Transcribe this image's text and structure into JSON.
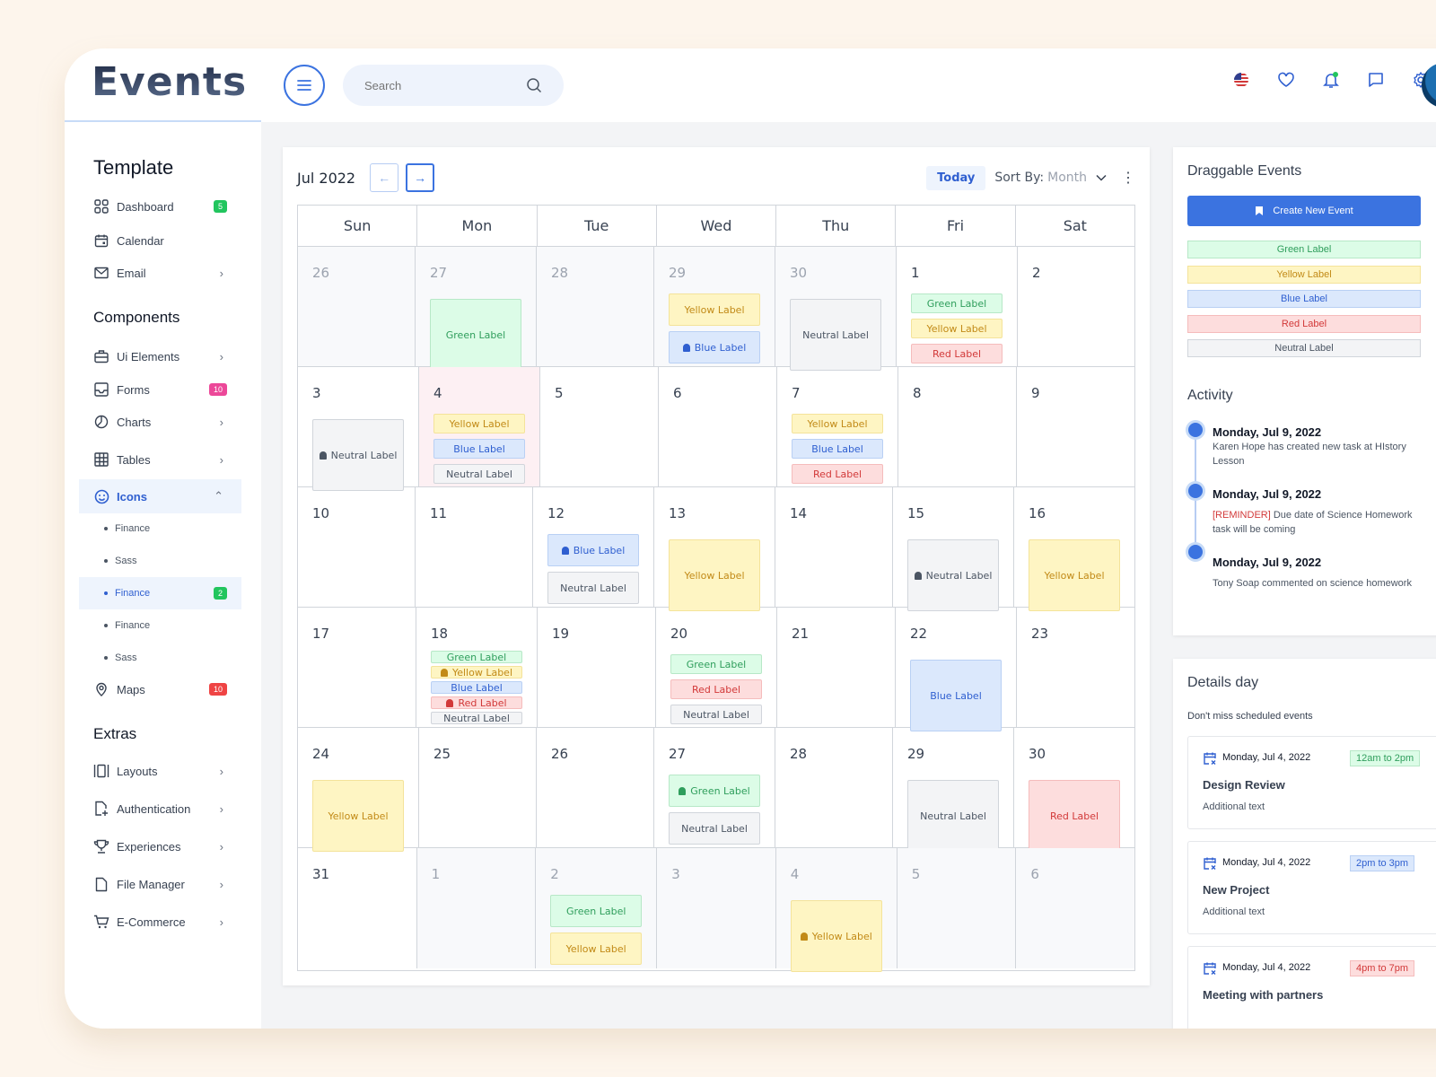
{
  "app": {
    "title": "Events"
  },
  "topbar": {
    "search_placeholder": "Search",
    "icons": [
      "us-flag-icon",
      "heart-icon",
      "bell-icon",
      "chat-icon",
      "gear-icon"
    ]
  },
  "sidebar": {
    "sections": {
      "template": "Template",
      "components": "Components",
      "extras": "Extras"
    },
    "template_items": [
      {
        "label": "Dashboard",
        "badge": "5",
        "badge_color": "#22c55e"
      },
      {
        "label": "Calendar"
      },
      {
        "label": "Email",
        "chevron": true
      }
    ],
    "component_items": [
      {
        "label": "Ui Elements",
        "chevron": true
      },
      {
        "label": "Forms",
        "badge": "10",
        "badge_color": "#ec4899"
      },
      {
        "label": "Charts",
        "chevron": true
      },
      {
        "label": "Tables",
        "chevron": true
      },
      {
        "label": "Icons",
        "expanded": true,
        "active": true
      }
    ],
    "icons_subitems": [
      {
        "label": "Finance"
      },
      {
        "label": "Sass"
      },
      {
        "label": "Finance",
        "active": true,
        "badge": "2",
        "badge_color": "#22c55e"
      },
      {
        "label": "Finance"
      },
      {
        "label": "Sass"
      }
    ],
    "maps": {
      "label": "Maps",
      "badge": "10",
      "badge_color": "#ef4444"
    },
    "extra_items": [
      {
        "label": "Layouts"
      },
      {
        "label": "Authentication"
      },
      {
        "label": "Experiences"
      },
      {
        "label": "File Manager"
      },
      {
        "label": "E-Commerce"
      }
    ]
  },
  "calendar": {
    "month_label": "Jul 2022",
    "today_label": "Today",
    "sort_label": "Sort By:",
    "sort_value": "Month",
    "weekdays": [
      "Sun",
      "Mon",
      "Tue",
      "Wed",
      "Thu",
      "Fri",
      "Sat"
    ],
    "weeks": [
      [
        {
          "d": "26",
          "muted": true,
          "events": []
        },
        {
          "d": "27",
          "muted": true,
          "layout": "tall",
          "events": [
            {
              "c": "green",
              "t": "Green Label"
            }
          ]
        },
        {
          "d": "28",
          "muted": true,
          "events": []
        },
        {
          "d": "29",
          "muted": true,
          "layout": "two",
          "events": [
            {
              "c": "yellow",
              "t": "Yellow Label"
            },
            {
              "c": "blue",
              "t": "Blue Label",
              "bell": true
            }
          ]
        },
        {
          "d": "30",
          "muted": true,
          "layout": "tall",
          "events": [
            {
              "c": "neutral",
              "t": "Neutral Label"
            }
          ]
        },
        {
          "d": "1",
          "layout": "three",
          "events": [
            {
              "c": "green",
              "t": "Green Label"
            },
            {
              "c": "yellow",
              "t": "Yellow Label"
            },
            {
              "c": "red",
              "t": "Red Label"
            }
          ]
        },
        {
          "d": "2",
          "events": []
        }
      ],
      [
        {
          "d": "3",
          "layout": "tall",
          "events": [
            {
              "c": "neutral",
              "t": "Neutral Label",
              "bell": true
            }
          ]
        },
        {
          "d": "4",
          "highlight": true,
          "layout": "three",
          "events": [
            {
              "c": "yellow",
              "t": "Yellow Label"
            },
            {
              "c": "blue",
              "t": "Blue Label"
            },
            {
              "c": "neutral",
              "t": "Neutral Label"
            }
          ]
        },
        {
          "d": "5",
          "events": []
        },
        {
          "d": "6",
          "events": []
        },
        {
          "d": "7",
          "layout": "three",
          "events": [
            {
              "c": "yellow",
              "t": "Yellow Label"
            },
            {
              "c": "blue",
              "t": "Blue Label"
            },
            {
              "c": "red",
              "t": "Red Label"
            }
          ]
        },
        {
          "d": "8",
          "events": []
        },
        {
          "d": "9",
          "events": []
        }
      ],
      [
        {
          "d": "10",
          "events": []
        },
        {
          "d": "11",
          "events": []
        },
        {
          "d": "12",
          "layout": "two",
          "events": [
            {
              "c": "blue",
              "t": "Blue Label",
              "bell": true
            },
            {
              "c": "neutral",
              "t": "Neutral Label"
            }
          ]
        },
        {
          "d": "13",
          "layout": "tall",
          "events": [
            {
              "c": "yellow",
              "t": "Yellow Label"
            }
          ]
        },
        {
          "d": "14",
          "events": []
        },
        {
          "d": "15",
          "layout": "tall",
          "events": [
            {
              "c": "neutral",
              "t": "Neutral Label",
              "bell": true
            }
          ]
        },
        {
          "d": "16",
          "layout": "tall",
          "events": [
            {
              "c": "yellow",
              "t": "Yellow Label"
            }
          ]
        }
      ],
      [
        {
          "d": "17",
          "events": []
        },
        {
          "d": "18",
          "layout": "tight",
          "events": [
            {
              "c": "green",
              "t": "Green Label"
            },
            {
              "c": "yellow",
              "t": "Yellow Label",
              "bell": true
            },
            {
              "c": "blue",
              "t": "Blue Label"
            },
            {
              "c": "red",
              "t": "Red Label",
              "bell": true
            },
            {
              "c": "neutral",
              "t": "Neutral Label"
            }
          ]
        },
        {
          "d": "19",
          "events": []
        },
        {
          "d": "20",
          "layout": "three",
          "events": [
            {
              "c": "green",
              "t": "Green Label"
            },
            {
              "c": "red",
              "t": "Red Label"
            },
            {
              "c": "neutral",
              "t": "Neutral Label"
            }
          ]
        },
        {
          "d": "21",
          "events": []
        },
        {
          "d": "22",
          "layout": "tall",
          "events": [
            {
              "c": "blue",
              "t": "Blue Label"
            }
          ]
        },
        {
          "d": "23",
          "events": []
        }
      ],
      [
        {
          "d": "24",
          "layout": "tall",
          "events": [
            {
              "c": "yellow",
              "t": "Yellow Label"
            }
          ]
        },
        {
          "d": "25",
          "events": []
        },
        {
          "d": "26",
          "events": []
        },
        {
          "d": "27",
          "layout": "two",
          "events": [
            {
              "c": "green",
              "t": "Green Label",
              "bell": true
            },
            {
              "c": "neutral",
              "t": "Neutral Label"
            }
          ]
        },
        {
          "d": "28",
          "events": []
        },
        {
          "d": "29",
          "layout": "tall",
          "events": [
            {
              "c": "neutral",
              "t": "Neutral Label"
            }
          ]
        },
        {
          "d": "30",
          "layout": "tall",
          "events": [
            {
              "c": "red",
              "t": "Red Label"
            }
          ]
        }
      ],
      [
        {
          "d": "31",
          "events": []
        },
        {
          "d": "1",
          "muted": true,
          "events": []
        },
        {
          "d": "2",
          "muted": true,
          "layout": "two",
          "events": [
            {
              "c": "green",
              "t": "Green Label"
            },
            {
              "c": "yellow",
              "t": "Yellow Label"
            }
          ]
        },
        {
          "d": "3",
          "muted": true,
          "events": []
        },
        {
          "d": "4",
          "muted": true,
          "layout": "tall",
          "events": [
            {
              "c": "yellow",
              "t": "Yellow Label",
              "bell": true
            }
          ]
        },
        {
          "d": "5",
          "muted": true,
          "events": []
        },
        {
          "d": "6",
          "muted": true,
          "events": []
        }
      ]
    ]
  },
  "draggable": {
    "title": "Draggable Events",
    "create_label": "Create New Event",
    "items": [
      {
        "c": "green",
        "t": "Green Label"
      },
      {
        "c": "yellow",
        "t": "Yellow Label"
      },
      {
        "c": "blue",
        "t": "Blue Label"
      },
      {
        "c": "red",
        "t": "Red Label"
      },
      {
        "c": "neutral",
        "t": "Neutral Label"
      }
    ]
  },
  "activity": {
    "title": "Activity",
    "items": [
      {
        "date": "Monday, Jul 9, 2022",
        "text": "Karen Hope has created new task at HIstory Lesson"
      },
      {
        "date": "Monday, Jul 9, 2022",
        "prefix": "[REMINDER]",
        "text": " Due date of Science Homework task will be coming"
      },
      {
        "date": "Monday, Jul 9, 2022",
        "text": "Tony Soap commented on science homework"
      }
    ]
  },
  "details": {
    "title": "Details day",
    "subtitle": "Don't miss scheduled events",
    "items": [
      {
        "date": "Monday, Jul 4, 2022",
        "time": "12am to 2pm",
        "color": "green",
        "title": "Design Review",
        "sub": "Additional text"
      },
      {
        "date": "Monday, Jul 4, 2022",
        "time": "2pm to 3pm",
        "color": "blue",
        "title": "New Project",
        "sub": "Additional text"
      },
      {
        "date": "Monday, Jul 4, 2022",
        "time": "4pm to 7pm",
        "color": "red",
        "title": "Meeting with partners",
        "sub": ""
      }
    ]
  }
}
